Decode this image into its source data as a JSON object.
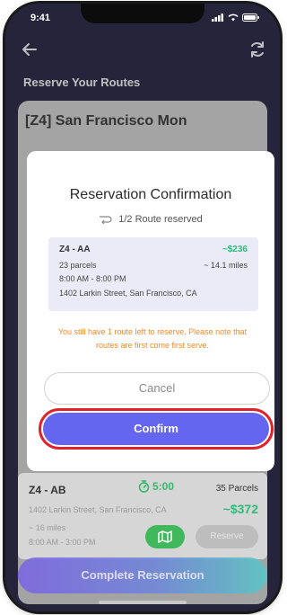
{
  "status_bar": {
    "time": "9:41"
  },
  "header": {
    "title": "Reserve Your Routes"
  },
  "background_card": {
    "title": "[Z4] San Francisco Mon"
  },
  "modal": {
    "title": "Reservation Confirmation",
    "reserved_status": "1/2  Route reserved",
    "route": {
      "name": "Z4 - AA",
      "price": "~$236",
      "parcels": "23 parcels",
      "miles": "~ 14.1 miles",
      "time": "8:00 AM - 8:00 PM",
      "address": "1402 Larkin Street, San Francisco, CA"
    },
    "warning": "You still have 1 route left to reserve. Please note that routes are first come first serve.",
    "cancel_label": "Cancel",
    "confirm_label": "Confirm"
  },
  "route_card": {
    "name": "Z4 - AB",
    "timer": "5:00",
    "parcels": "35 Parcels",
    "address": "1402 Larkin Street, San Francisco, CA",
    "price": "~$372",
    "miles": "~ 16 miles",
    "time": "8:00 AM - 3:00 PM",
    "reserve_label": "Reserve"
  },
  "footer": {
    "complete_label": "Complete Reservation"
  },
  "colors": {
    "header_bg": "#2a2747",
    "primary": "#6466f0",
    "price_green": "#2dbb7a",
    "warning_orange": "#f08a2a",
    "highlight_red": "#e0222a"
  }
}
